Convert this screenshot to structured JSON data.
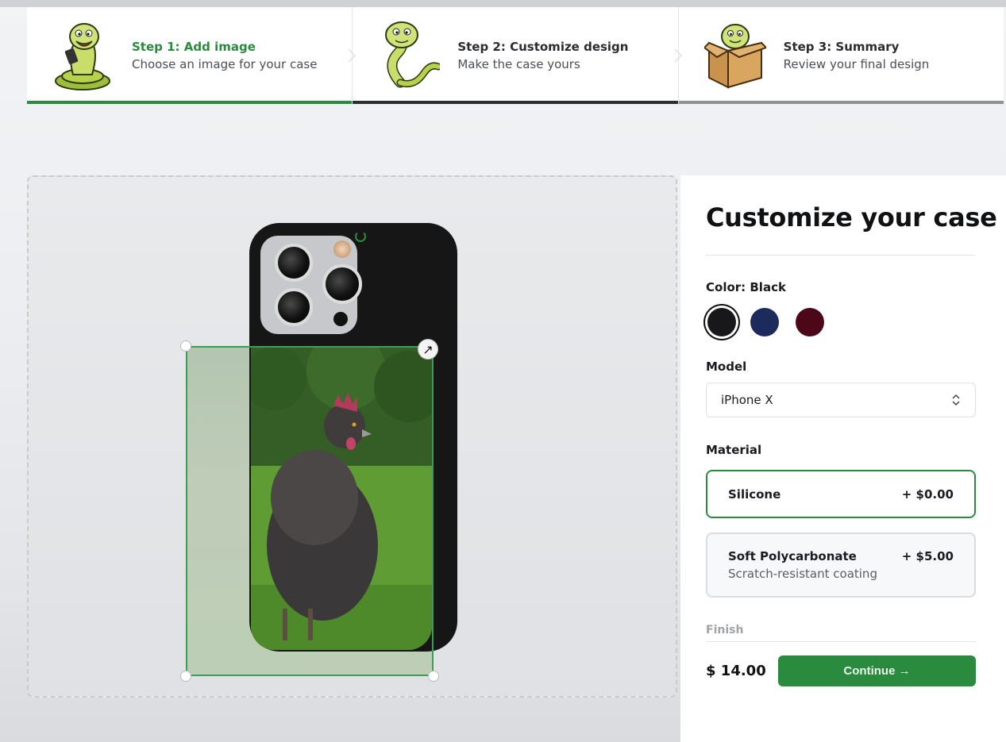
{
  "steps": [
    {
      "title": "Step 1: Add image",
      "subtitle": "Choose an image for your case",
      "mascot": "snake-holding-phone-icon",
      "state": "current"
    },
    {
      "title": "Step 2: Customize design",
      "subtitle": "Make the case yours",
      "mascot": "snake-icon",
      "state": "upcoming"
    },
    {
      "title": "Step 3: Summary",
      "subtitle": "Review your final design",
      "mascot": "snake-in-box-icon",
      "state": "upcoming"
    }
  ],
  "panel": {
    "heading": "Customize your case",
    "color_label": "Color: Black",
    "colors": [
      {
        "name": "Black",
        "hex": "#18181b",
        "selected": true
      },
      {
        "name": "Blue",
        "hex": "#1c2a5c",
        "selected": false
      },
      {
        "name": "Rose",
        "hex": "#4c0719",
        "selected": false
      }
    ],
    "model_label": "Model",
    "model_value": "iPhone X",
    "material_label": "Material",
    "materials": [
      {
        "name": "Silicone",
        "price": "+ $0.00",
        "desc": "",
        "selected": true
      },
      {
        "name": "Soft Polycarbonate",
        "price": "+ $5.00",
        "desc": "Scratch-resistant coating",
        "selected": false
      }
    ],
    "finish_label": "Finish",
    "total": "$ 14.00",
    "continue_label": "Continue →"
  },
  "accent": "#2a8a3e"
}
